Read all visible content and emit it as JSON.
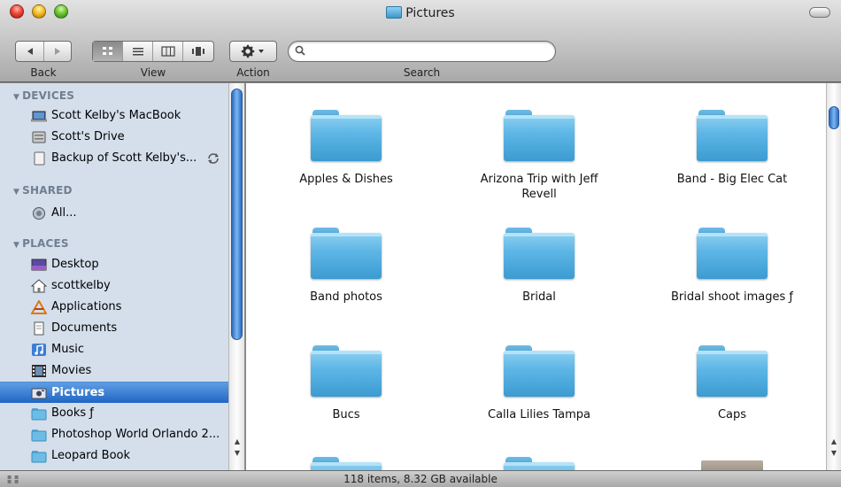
{
  "window": {
    "title": "Pictures"
  },
  "toolbar": {
    "back_label": "Back",
    "view_label": "View",
    "action_label": "Action",
    "search_label": "Search",
    "search_value": "",
    "view_modes": [
      "icon-view-icon",
      "list-view-icon",
      "column-view-icon",
      "coverflow-view-icon"
    ],
    "active_view": "icon-view-icon"
  },
  "sidebar": {
    "devices_header": "DEVICES",
    "shared_header": "SHARED",
    "places_header": "PLACES",
    "devices": [
      {
        "label": "Scott Kelby's MacBook",
        "icon": "laptop-icon"
      },
      {
        "label": "Scott's Drive",
        "icon": "hard-drive-icon"
      },
      {
        "label": "Backup of Scott Kelby's...",
        "icon": "external-drive-icon"
      }
    ],
    "shared": [
      {
        "label": "All...",
        "icon": "network-icon"
      }
    ],
    "places": [
      {
        "label": "Desktop",
        "icon": "desktop-icon"
      },
      {
        "label": "scottkelby",
        "icon": "home-icon"
      },
      {
        "label": "Applications",
        "icon": "applications-icon"
      },
      {
        "label": "Documents",
        "icon": "documents-icon"
      },
      {
        "label": "Music",
        "icon": "music-icon"
      },
      {
        "label": "Movies",
        "icon": "movies-icon"
      },
      {
        "label": "Pictures",
        "icon": "pictures-icon"
      },
      {
        "label": "Books ƒ",
        "icon": "folder-icon"
      },
      {
        "label": "Photoshop World Orlando 2...",
        "icon": "folder-icon"
      },
      {
        "label": "Leopard Book",
        "icon": "folder-icon"
      }
    ],
    "selected": "Pictures"
  },
  "folders": [
    "Apples & Dishes",
    "Arizona Trip with Jeff Revell",
    "Band - Big Elec Cat",
    "Band photos",
    "Bridal",
    "Bridal shoot images ƒ",
    "Bucs",
    "Calla Lilies Tampa",
    "Caps"
  ],
  "status": {
    "text": "118 items, 8.32 GB available"
  },
  "colors": {
    "selection": "#3d7fd6",
    "sidebar_bg": "#d4dfeb",
    "folder": "#5db6e6"
  }
}
